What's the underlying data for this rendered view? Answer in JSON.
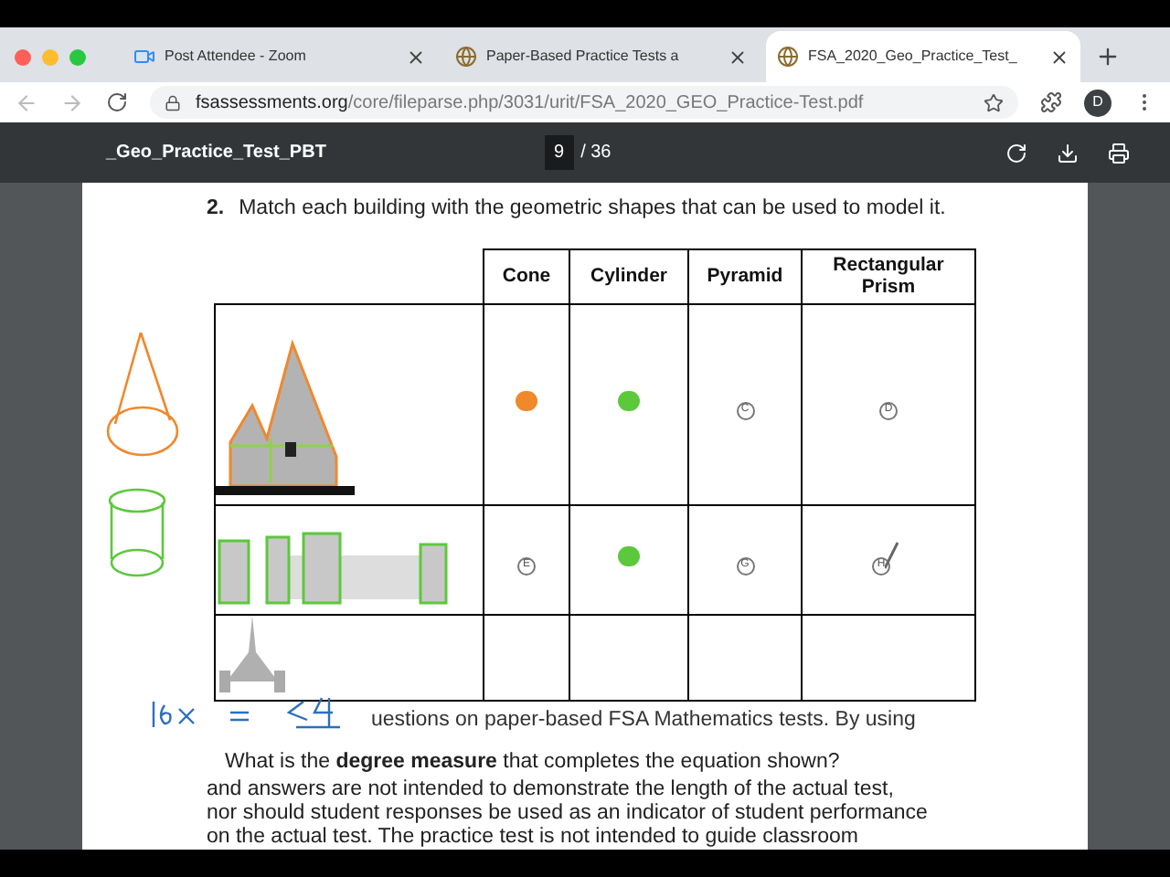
{
  "tabs": [
    {
      "title": "Post Attendee - Zoom",
      "selected": false
    },
    {
      "title": "Paper-Based Practice Tests a",
      "selected": false
    },
    {
      "title": "FSA_2020_Geo_Practice_Test_",
      "selected": true
    }
  ],
  "address_bar": {
    "url_host": "fsassessments.org",
    "url_path": "/core/fileparse.php/3031/urit/FSA_2020_GEO_Practice-Test.pdf"
  },
  "profile": {
    "initial": "D"
  },
  "pdf_toolbar": {
    "title": "_Geo_Practice_Test_PBT",
    "page": "9",
    "total": "/ 36"
  },
  "question": {
    "number": "2.",
    "text": "Match each building with the geometric shapes that can be used to model it."
  },
  "table": {
    "columns": [
      "Cone",
      "Cylinder",
      "Pyramid",
      "Rectangular Prism"
    ],
    "rows": [
      {
        "options": [
          {
            "kind": "filled",
            "color": "#f0882c"
          },
          {
            "kind": "filled",
            "color": "#5cc83c"
          },
          {
            "kind": "empty",
            "letter": "C"
          },
          {
            "kind": "empty",
            "letter": "D"
          }
        ]
      },
      {
        "options": [
          {
            "kind": "empty",
            "letter": "E"
          },
          {
            "kind": "filled",
            "color": "#5cc83c"
          },
          {
            "kind": "empty",
            "letter": "G"
          },
          {
            "kind": "scribbled",
            "letter": "H"
          }
        ]
      },
      {
        "options": []
      }
    ]
  },
  "overlap_text": {
    "line": "uestions on paper-based FSA Mathematics tests. By using",
    "question": "What is the **degree measure** that completes the equation shown?"
  },
  "paragraph": [
    "and answers are not intended to demonstrate the length of the actual test,",
    "nor should student responses be used as an indicator of student performance",
    "on the actual test. The practice test is not intended to guide classroom"
  ]
}
